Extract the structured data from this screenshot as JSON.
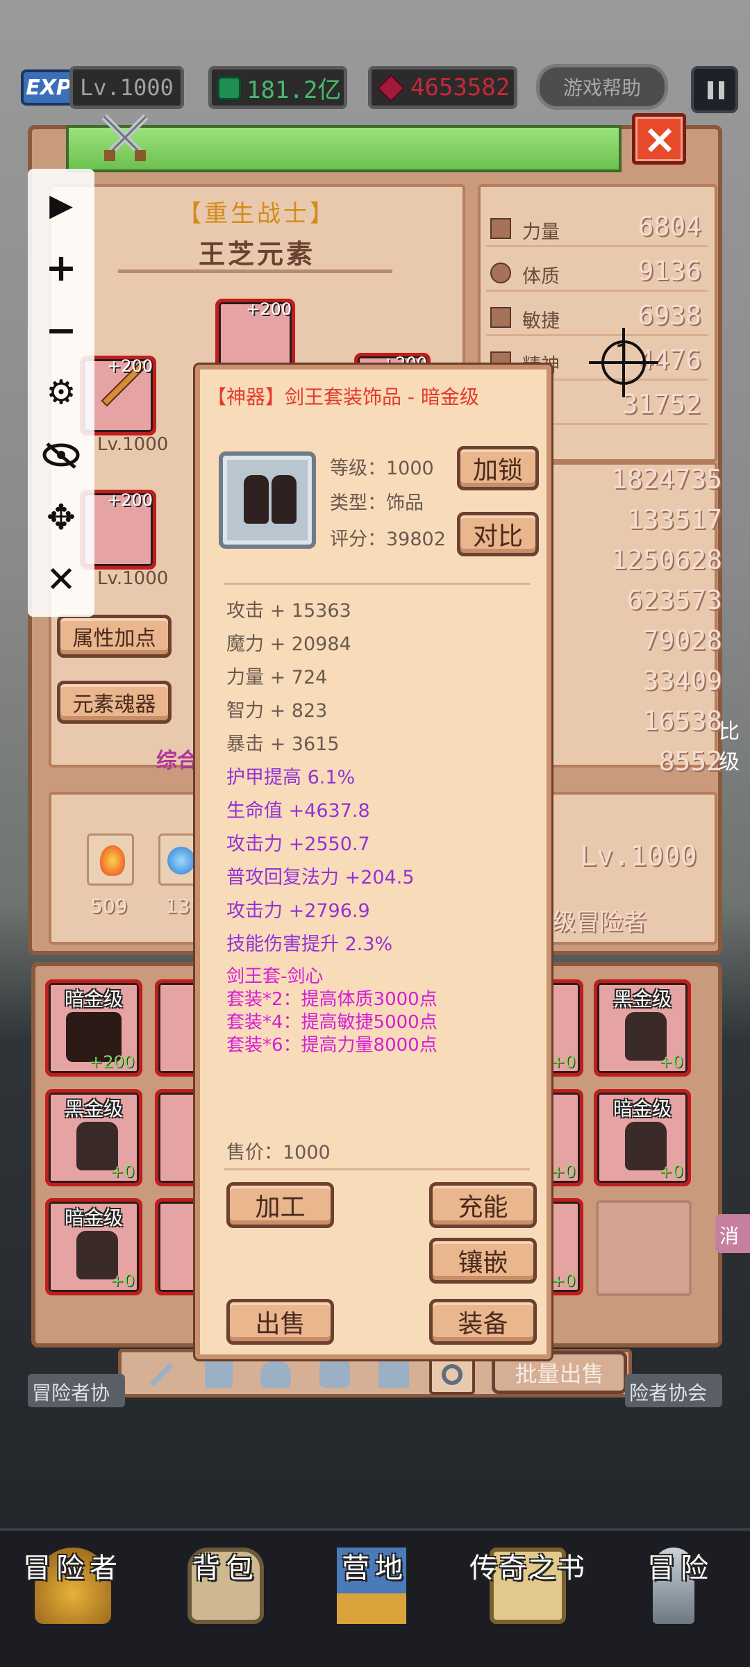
{
  "hud": {
    "exp_label": "EXP",
    "level": "Lv.1000",
    "gems": "181.2亿",
    "rubies": "4653582",
    "help_label": "游戏帮助"
  },
  "character": {
    "class_title": "【重生战士】",
    "name": "王芝元素",
    "equip_top_plus": "+200",
    "equip_left1_plus": "+200",
    "equip_left1_level": "Lv.1000",
    "equip_left2_plus": "+200",
    "equip_left2_level": "Lv.1000",
    "equip_right_plus": "+200",
    "attr_button": "属性加点",
    "soul_button": "元素魂器",
    "summary_partial": "综合",
    "res1_count": "509",
    "res2_count": "133",
    "bottom_level": "Lv.1000",
    "bottom_title_partial": "级冒险者"
  },
  "stats": [
    {
      "name": "力量",
      "value": "6804"
    },
    {
      "name": "体质",
      "value": "9136"
    },
    {
      "name": "敏捷",
      "value": "6938"
    },
    {
      "name": "精神",
      "value": "4476"
    },
    {
      "name": "力",
      "value": "31752"
    }
  ],
  "sub_stats": [
    "1824735",
    "133517",
    "1250628",
    "623573",
    "79028",
    "33409",
    "16538",
    "8552"
  ],
  "crosshair_number": "1",
  "item": {
    "title": "【神器】剑王套装饰品 - 暗金级",
    "level": "等级：1000",
    "type": "类型：饰品",
    "score": "评分：39802",
    "lock_button": "加锁",
    "compare_button": "对比",
    "base_attrs": [
      "攻击 + 15363",
      "魔力 + 20984",
      "力量 + 724",
      "智力 + 823",
      "暴击 + 3615"
    ],
    "extra_attrs": [
      "护甲提高 6.1%",
      "生命值 +4637.8",
      "攻击力 +2550.7",
      "普攻回复法力 +204.5",
      "攻击力 +2796.9",
      "技能伤害提升 2.3%"
    ],
    "set_name": "剑王套-剑心",
    "set_bonuses": [
      "套装*2：提高体质3000点",
      "套装*4：提高敏捷5000点",
      "套装*6：提高力量8000点"
    ],
    "price": "售价：1000",
    "process_button": "加工",
    "charge_button": "充能",
    "inlay_button": "镶嵌",
    "sell_button": "出售",
    "equip_button": "装备"
  },
  "inventory": {
    "slots": [
      {
        "label": "暗金级",
        "plus": "+200"
      },
      {
        "label": "白",
        "plus": ""
      },
      {
        "label": "级",
        "plus": "+0"
      },
      {
        "label": "黑金级",
        "plus": "+0"
      },
      {
        "label": "黑金级",
        "plus": "+0"
      },
      {
        "label": "暗",
        "plus": ""
      },
      {
        "label": "级",
        "plus": "+0"
      },
      {
        "label": "暗金级",
        "plus": "+0"
      },
      {
        "label": "暗金级",
        "plus": "+0"
      },
      {
        "label": "暗",
        "plus": ""
      },
      {
        "label": "级",
        "plus": "+0"
      }
    ],
    "bulk_sell": "批量出售",
    "left_tab_partial": "冒险者协",
    "right_tab_partial": "险者协会",
    "cancel_partial": "消",
    "side_partial": "比级"
  },
  "nav": [
    {
      "label": "冒险者",
      "icon": "helmet-icon"
    },
    {
      "label": "背包",
      "icon": "backpack-icon"
    },
    {
      "label": "营地",
      "icon": "banner-icon"
    },
    {
      "label": "传奇之书",
      "icon": "book-icon"
    },
    {
      "label": "冒险",
      "icon": "sword-icon"
    }
  ],
  "colors": {
    "legendary_red": "#e23b2b",
    "extra_purple": "#9333d4",
    "set_magenta": "#d61ed6",
    "slot_border": "#c01d1d"
  }
}
